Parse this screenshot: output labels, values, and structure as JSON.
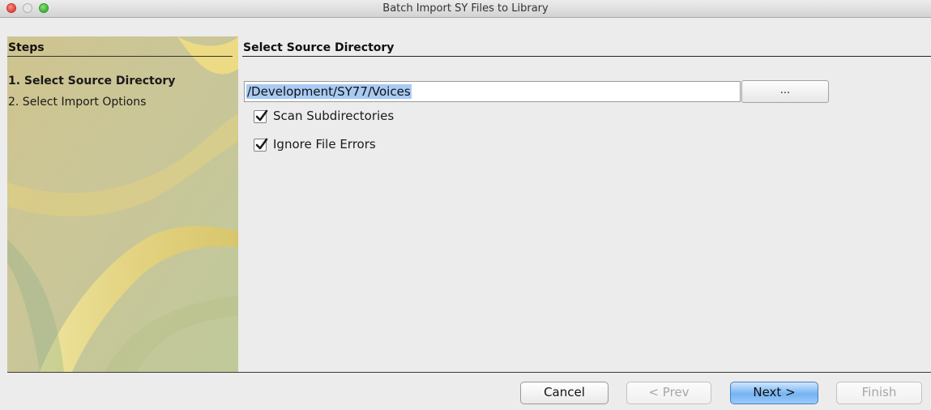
{
  "window": {
    "title": "Batch Import SY Files to Library"
  },
  "steps": {
    "header": "Steps",
    "items": [
      {
        "label": "1. Select Source Directory",
        "active": true
      },
      {
        "label": "2. Select Import Options",
        "active": false
      }
    ]
  },
  "main": {
    "header": "Select Source Directory",
    "path_value": "/Development/SY77/Voices",
    "browse_label": "...",
    "options": [
      {
        "label": "Scan Subdirectories",
        "checked": true
      },
      {
        "label": "Ignore File Errors",
        "checked": true
      }
    ]
  },
  "buttons": {
    "cancel": "Cancel",
    "prev": "< Prev",
    "next": "Next >",
    "finish": "Finish"
  },
  "colors": {
    "selection": "#a9caf4",
    "default_button": "#75b3f3",
    "side_panel": "#cfc896",
    "close": "#e0443e",
    "zoom": "#3cb43a"
  }
}
